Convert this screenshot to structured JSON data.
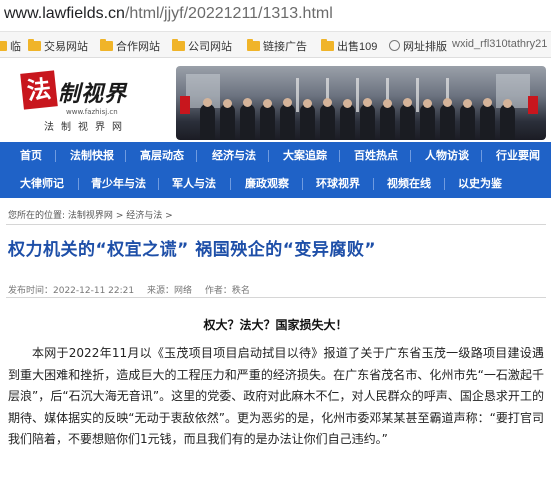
{
  "browser": {
    "url_host": "www.lawfields.cn",
    "url_path": "/html/jjyf/20221211/1313.html",
    "bookmarks": [
      {
        "label": "临",
        "icon": "folder-icon"
      },
      {
        "label": "交易网站",
        "icon": "folder-icon"
      },
      {
        "label": "合作网站",
        "icon": "folder-icon"
      },
      {
        "label": "公司网站",
        "icon": "folder-icon"
      },
      {
        "label": "链接广告",
        "icon": "folder-icon"
      },
      {
        "label": "出售109",
        "icon": "folder-icon"
      },
      {
        "label": "网址排版",
        "icon": "globe-icon"
      },
      {
        "label": "wxid_rfl310tathry21",
        "icon": "none"
      }
    ]
  },
  "site": {
    "logo_char": "法",
    "logo_text": "制视界",
    "logo_url": "www.fazhisj.cn",
    "logo_sub": "法制视界网"
  },
  "nav": {
    "row1": [
      "首页",
      "法制快报",
      "高层动态",
      "经济与法",
      "大案追踪",
      "百姓热点",
      "人物访谈",
      "行业要闻"
    ],
    "row2": [
      "大律师记",
      "青少年与法",
      "军人与法",
      "廉政观察",
      "环球视界",
      "视频在线",
      "以史为鉴"
    ]
  },
  "breadcrumb": {
    "prefix": "您所在的位置:",
    "home": "法制视界网",
    "sep": ">",
    "section": "经济与法",
    "tail": ">"
  },
  "article": {
    "title": "权力机关的“权宜之谎” 祸国殃企的“变异腐败”",
    "published": "发布时间：2022-12-11 22:21",
    "source": "来源：网络",
    "author": "作者：秩名",
    "lead": "权大？法大？国家损失大！",
    "body": "本网于2022年11月以《玉茂项目项目启动拭目以待》报道了关于广东省玉茂一级路项目建设遇到重大困难和挫折，造成巨大的工程压力和严重的经济损失。在广东省茂名市、化州市先“一石激起千层浪”，后“石沉大海无音讯”。这里的党委、政府对此麻木不仁，对人民群众的呼声、国企恳求开工的期待、媒体据实的反映“无动于衷敌依然”。更为恶劣的是，化州市委邓某某甚至霸道声称：“要打官司我们陪着，不要想赔你们1元钱，而且我们有的是办法让你们自己违约。”"
  }
}
